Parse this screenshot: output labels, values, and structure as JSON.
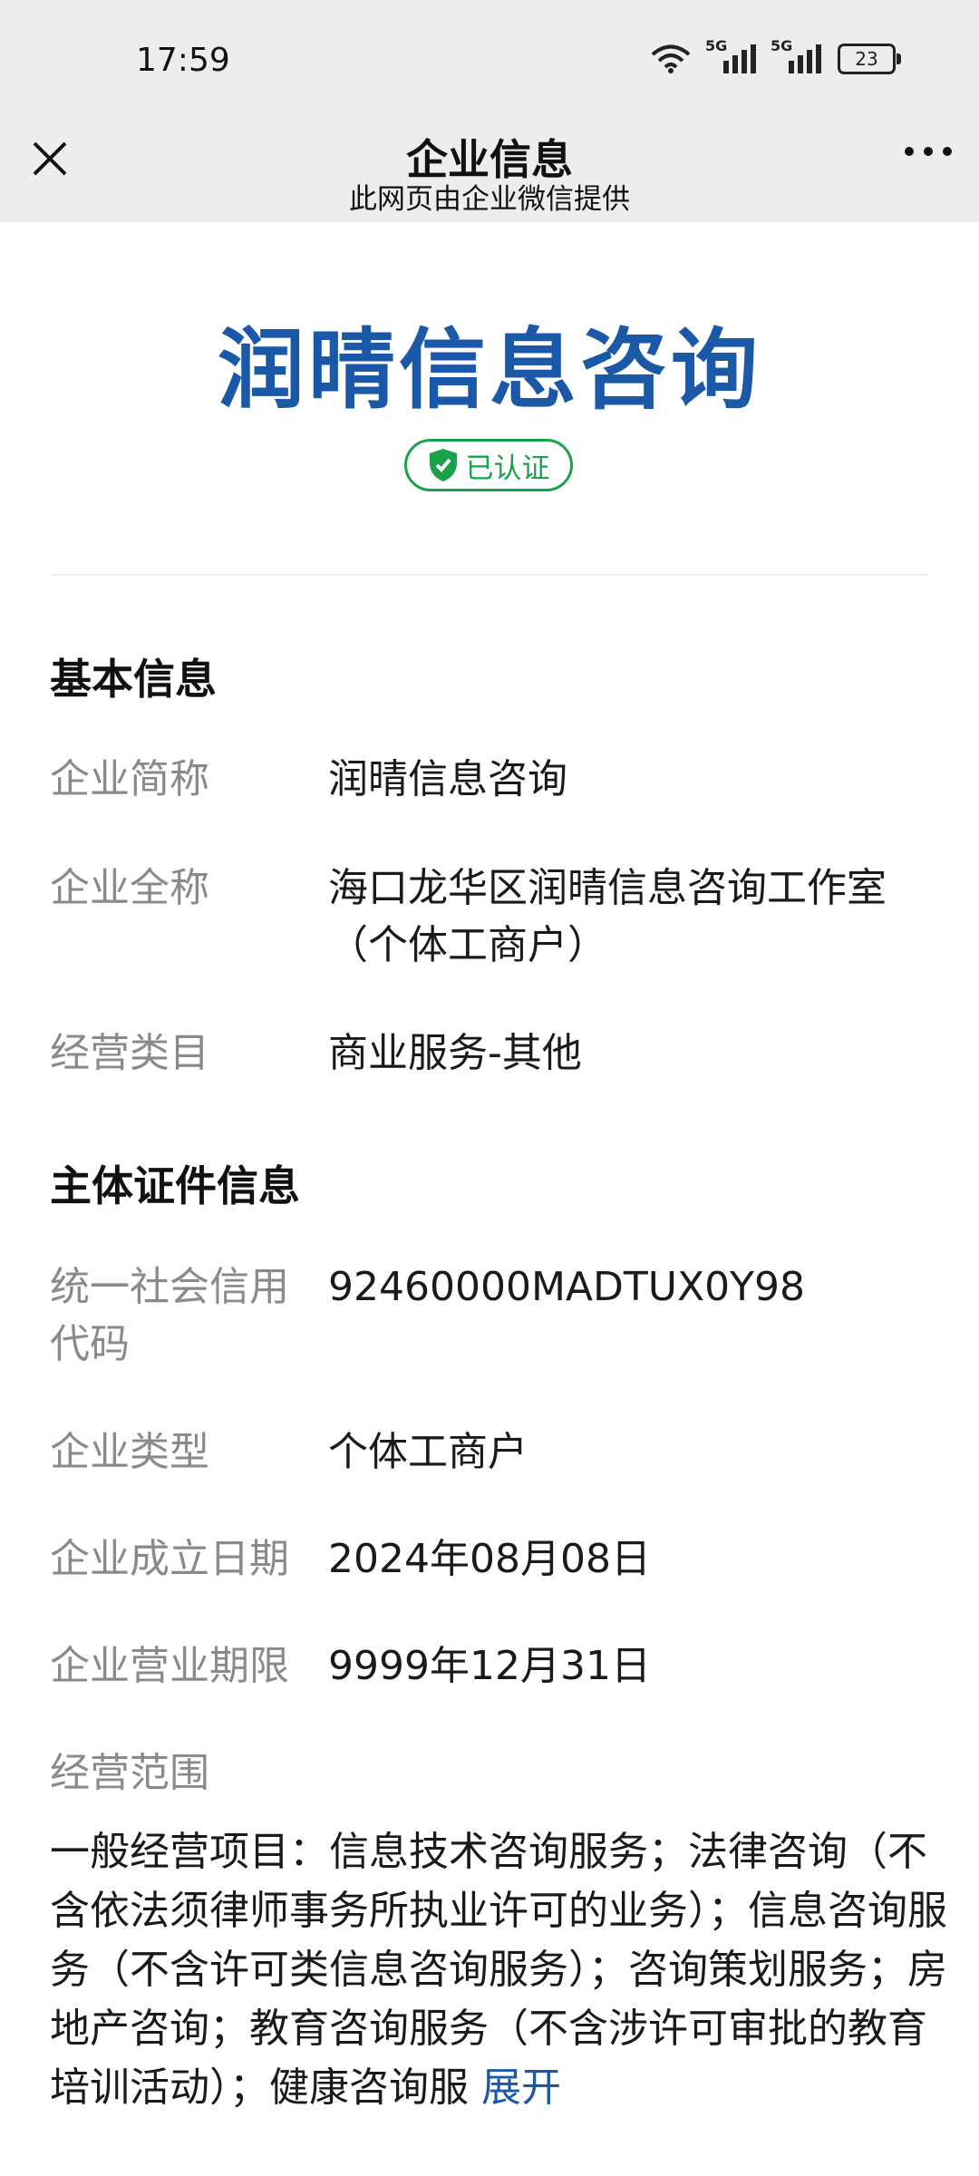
{
  "status_bar": {
    "time": "17:59",
    "network_1": "5G",
    "network_2": "5G",
    "battery": "23",
    "icons": [
      "wifi-icon",
      "signal-5g-icon",
      "signal-5g-icon",
      "battery-icon"
    ]
  },
  "navbar": {
    "title": "企业信息",
    "subtitle": "此网页由企业微信提供",
    "close_icon": "close-icon",
    "more_icon": "more-icon"
  },
  "header": {
    "company_name": "润晴信息咨询",
    "verified_label": "已认证",
    "verified_icon": "shield-check-icon",
    "brand_color": "#1b58a8",
    "verified_color": "#19a24b"
  },
  "basic_info": {
    "title": "基本信息",
    "rows": [
      {
        "label": "企业简称",
        "value": "润晴信息咨询"
      },
      {
        "label": "企业全称",
        "value": "海口龙华区润晴信息咨询工作室（个体工商户）"
      },
      {
        "label": "经营类目",
        "value": "商业服务-其他"
      }
    ]
  },
  "cert_info": {
    "title": "主体证件信息",
    "rows": [
      {
        "label": "统一社会信用代码",
        "value": "92460000MADTUX0Y98"
      },
      {
        "label": "企业类型",
        "value": "个体工商户"
      },
      {
        "label": "企业成立日期",
        "value": "2024年08月08日"
      },
      {
        "label": "企业营业期限",
        "value": "9999年12月31日"
      }
    ],
    "scope_label": "经营范围",
    "scope_text": "一般经营项目：信息技术咨询服务；法律咨询（不含依法须律师事务所执业许可的业务）；信息咨询服务（不含许可类信息咨询服务）；咨询策划服务；房地产咨询；教育咨询服务（不含涉许可审批的教育培训活动）；健康咨询服",
    "expand_label": "展开"
  }
}
